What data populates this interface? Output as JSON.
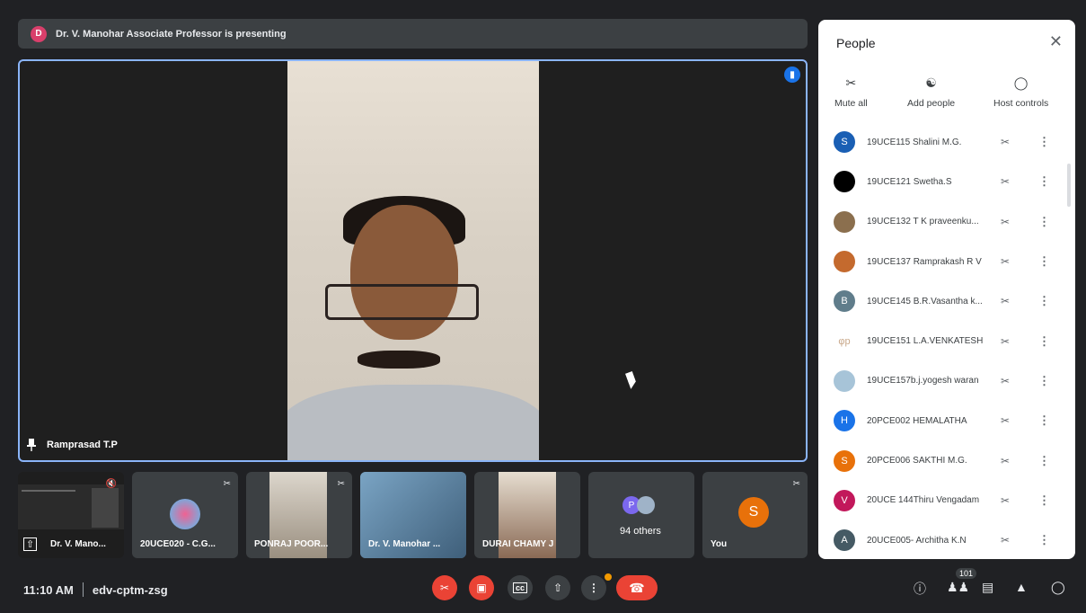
{
  "presenting": {
    "avatar_letter": "D",
    "text": "Dr. V. Manohar Associate Professor is presenting",
    "avatar_color": "#d93f6b"
  },
  "main_tile": {
    "pinned_name": "Ramprasad T.P"
  },
  "thumbnails": [
    {
      "label": "Dr. V. Mano...",
      "muted": true
    },
    {
      "label": "20UCE020 - C.G...",
      "muted": true
    },
    {
      "label": "PONRAJ POOR...",
      "muted": true
    },
    {
      "label": "Dr. V. Manohar ...",
      "muted": false
    },
    {
      "label": "DURAI CHAMY J",
      "muted": false
    },
    {
      "label": "94 others",
      "avatar_letter": "P"
    },
    {
      "label": "You",
      "avatar_letter": "S",
      "muted": true
    }
  ],
  "people_panel": {
    "title": "People",
    "actions": {
      "mute_all": "Mute all",
      "add_people": "Add people",
      "host_controls": "Host controls"
    },
    "participants": [
      {
        "name": "19UCE115 Shalini M.G.",
        "letter": "S",
        "color": "#1a5fb4"
      },
      {
        "name": "19UCE121 Swetha.S",
        "letter": "",
        "color": "#000000"
      },
      {
        "name": "19UCE132 T K praveenku...",
        "letter": "",
        "color": "#8b6f4e"
      },
      {
        "name": "19UCE137 Ramprakash R V",
        "letter": "",
        "color": "#c46a2e"
      },
      {
        "name": "19UCE145 B.R.Vasantha k...",
        "letter": "B",
        "color": "#607d8b"
      },
      {
        "name": "19UCE151 L.A.VENKATESH",
        "letter": "φp",
        "color": "#ffffff"
      },
      {
        "name": "19UCE157b.j.yogesh waran",
        "letter": "",
        "color": "#a7c4d8"
      },
      {
        "name": "20PCE002 HEMALATHA",
        "letter": "H",
        "color": "#1a73e8"
      },
      {
        "name": "20PCE006 SAKTHI M.G.",
        "letter": "S",
        "color": "#e8710a"
      },
      {
        "name": "20UCE 144Thiru Vengadam",
        "letter": "V",
        "color": "#c2185b"
      },
      {
        "name": "20UCE005- Architha K.N",
        "letter": "A",
        "color": "#455a64"
      }
    ]
  },
  "bottom_bar": {
    "time": "11:10 AM",
    "meeting_code": "edv-cptm-zsg",
    "participant_count": "101"
  }
}
